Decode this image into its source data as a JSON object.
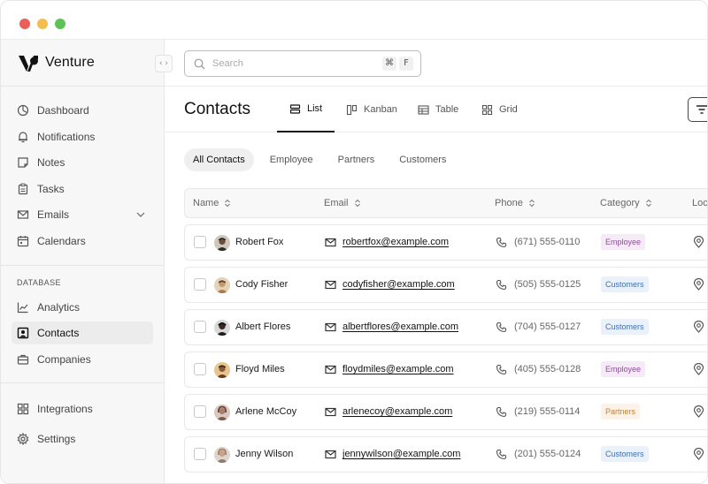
{
  "app": {
    "name": "Venture"
  },
  "sidebar": {
    "primary": [
      {
        "label": "Dashboard",
        "icon": "dashboard-icon"
      },
      {
        "label": "Notifications",
        "icon": "bell-icon"
      },
      {
        "label": "Notes",
        "icon": "note-icon"
      },
      {
        "label": "Tasks",
        "icon": "clipboard-icon"
      },
      {
        "label": "Emails",
        "icon": "mail-icon"
      },
      {
        "label": "Calendars",
        "icon": "calendar-icon"
      }
    ],
    "section_label": "DATABASE",
    "database": [
      {
        "label": "Analytics",
        "icon": "chart-line-icon"
      },
      {
        "label": "Contacts",
        "icon": "contact-icon",
        "active": true
      },
      {
        "label": "Companies",
        "icon": "briefcase-icon"
      }
    ],
    "footer": [
      {
        "label": "Integrations",
        "icon": "grid-icon"
      },
      {
        "label": "Settings",
        "icon": "gear-icon"
      }
    ]
  },
  "search": {
    "placeholder": "Search",
    "shortcut": [
      "⌘",
      "F"
    ]
  },
  "page": {
    "title": "Contacts"
  },
  "views": [
    {
      "label": "List",
      "active": true
    },
    {
      "label": "Kanban"
    },
    {
      "label": "Table"
    },
    {
      "label": "Grid"
    }
  ],
  "filters": [
    "All Contacts",
    "Employee",
    "Partners",
    "Customers"
  ],
  "table": {
    "columns": [
      "Name",
      "Email",
      "Phone",
      "Category",
      "Loc"
    ],
    "rows": [
      {
        "name": "Robert Fox",
        "email": "robertfox@example.com",
        "phone": "(671) 555-0110",
        "category": "Employee"
      },
      {
        "name": "Cody Fisher",
        "email": "codyfisher@example.com",
        "phone": "(505) 555-0125",
        "category": "Customers"
      },
      {
        "name": "Albert Flores",
        "email": "albertflores@example.com",
        "phone": "(704) 555-0127",
        "category": "Customers"
      },
      {
        "name": "Floyd Miles",
        "email": "floydmiles@example.com",
        "phone": "(405) 555-0128",
        "category": "Employee"
      },
      {
        "name": "Arlene McCoy",
        "email": "arlenecoy@example.com",
        "phone": "(219) 555-0114",
        "category": "Partners"
      },
      {
        "name": "Jenny Wilson",
        "email": "jennywilson@example.com",
        "phone": "(201) 555-0124",
        "category": "Customers"
      }
    ]
  },
  "colors": {
    "employee_badge": "#8f4d9c",
    "customers_badge": "#3f6fb0",
    "partners_badge": "#c1813b"
  }
}
